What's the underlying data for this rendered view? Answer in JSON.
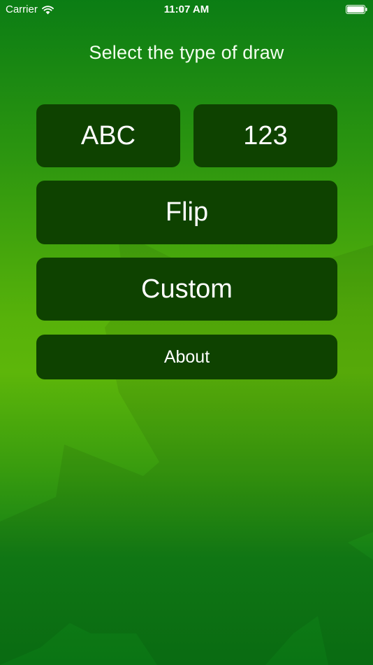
{
  "status_bar": {
    "carrier": "Carrier",
    "time": "11:07 AM"
  },
  "title": "Select the type of draw",
  "buttons": {
    "abc": "ABC",
    "numbers": "123",
    "flip": "Flip",
    "custom": "Custom",
    "about": "About"
  },
  "icons": {
    "wifi": "wifi-icon",
    "battery": "battery-icon",
    "background": "maple-leaf-icon"
  },
  "colors": {
    "button_bg": "#0e4200",
    "background_top": "#0b7d14",
    "background_mid": "#5db60a",
    "background_bottom": "#0a7414",
    "text": "#ffffff"
  }
}
